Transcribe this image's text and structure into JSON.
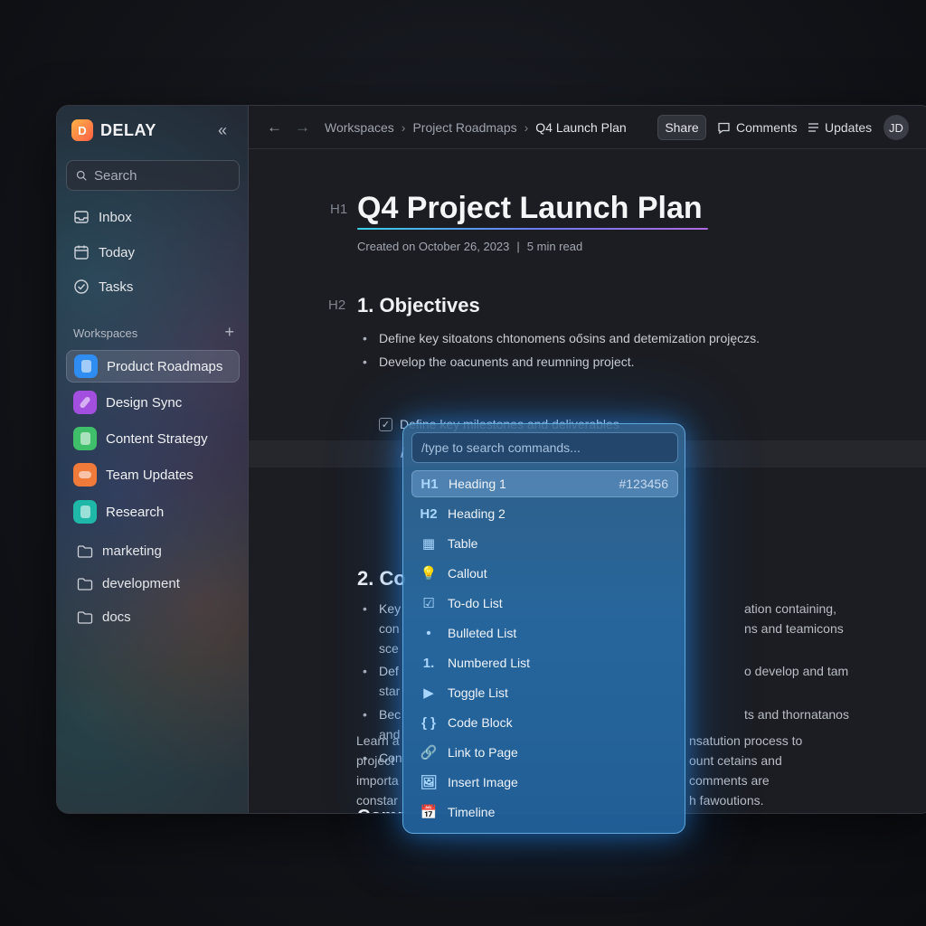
{
  "app": {
    "name": "DELAY",
    "logo_letter": "D"
  },
  "sidebar": {
    "search_placeholder": "Search",
    "nav": [
      {
        "label": "Inbox",
        "icon": "inbox-icon"
      },
      {
        "label": "Today",
        "icon": "calendar-icon"
      },
      {
        "label": "Tasks",
        "icon": "check-circle-icon"
      }
    ],
    "workspaces_header": "Workspaces",
    "workspaces": [
      {
        "label": "Product Roadmaps",
        "color": "#2f8cf0",
        "active": true
      },
      {
        "label": "Design Sync",
        "color": "#a24fe0"
      },
      {
        "label": "Content Strategy",
        "color": "#3fbf6a"
      },
      {
        "label": "Team Updates",
        "color": "#f07a3a"
      },
      {
        "label": "Research",
        "color": "#1fb8a8"
      }
    ],
    "folders": [
      {
        "label": "marketing"
      },
      {
        "label": "development"
      },
      {
        "label": "docs"
      }
    ]
  },
  "topbar": {
    "breadcrumbs": [
      "Workspaces",
      "Project Roadmaps",
      "Q4 Launch Plan"
    ],
    "share_label": "Share",
    "comments_label": "Comments",
    "updates_label": "Updates",
    "avatar_initials": "JD"
  },
  "doc": {
    "h1_marker": "H1",
    "title": "Q4 Project Launch Plan",
    "created": "Created on October 26, 2023",
    "read_time": "5 min read",
    "h2_marker": "H2",
    "section1_title": "1. Objectives",
    "bullets1": [
      "Define key sitoatons chtonomens oősins and detemization projęczs.",
      "Develop the oacunents and reumning project."
    ],
    "todo_label": "Define key milestones and deliverables",
    "slash": "/",
    "section2_title": "2. Co",
    "sec2_lines_left": [
      "Key",
      "con",
      "sce",
      "Def",
      "star",
      "Bec",
      "and",
      "Con"
    ],
    "sec2_lines_right": [
      "ation containing,",
      "ns and teamicons",
      "o develop and tam",
      "ts and thornatanos"
    ],
    "section3_title": "Comr",
    "sec3_left": [
      "Learn a",
      "project",
      "importa",
      "constar"
    ],
    "sec3_right": [
      "nsatution process to",
      "ount cetains and",
      "comments are",
      "h fawoutions."
    ]
  },
  "command_menu": {
    "placeholder": "/type to search commands...",
    "items": [
      {
        "icon": "H1",
        "label": "Heading 1",
        "hint": "#123456",
        "active": true
      },
      {
        "icon": "H2",
        "label": "Heading 2"
      },
      {
        "icon": "▦",
        "label": "Table"
      },
      {
        "icon": "💡",
        "label": "Callout"
      },
      {
        "icon": "☑",
        "label": "To-do List"
      },
      {
        "icon": "•",
        "label": "Bulleted List"
      },
      {
        "icon": "1.",
        "label": "Numbered List"
      },
      {
        "icon": "▶",
        "label": "Toggle List"
      },
      {
        "icon": "{ }",
        "label": "Code Block"
      },
      {
        "icon": "🔗",
        "label": "Link to Page"
      },
      {
        "icon": "🖼",
        "label": "Insert Image"
      },
      {
        "icon": "📅",
        "label": "Timeline"
      }
    ]
  }
}
